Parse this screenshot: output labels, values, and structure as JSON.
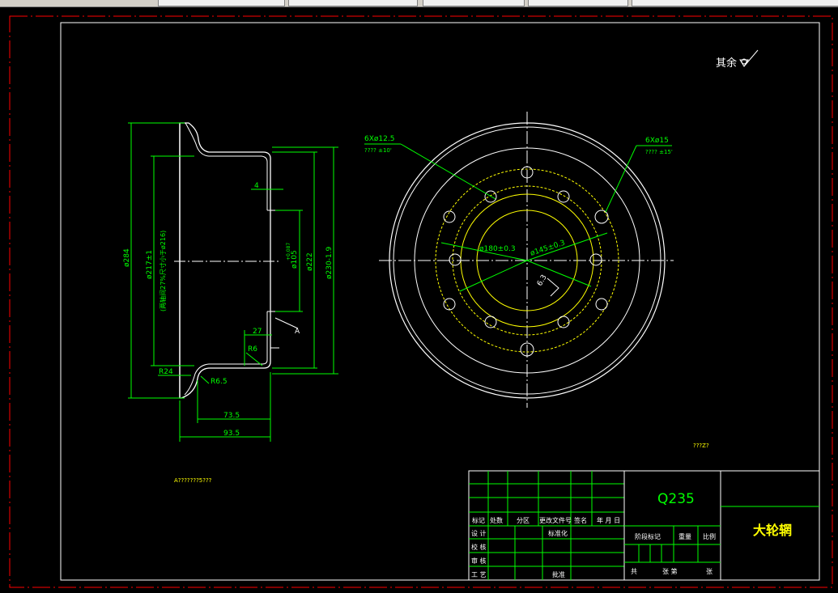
{
  "toolbar": {
    "tabs": [
      "",
      "",
      "",
      "",
      ""
    ]
  },
  "drawing": {
    "roughness_note": "其余",
    "material": "Q235",
    "part_name": "大轮辋",
    "bottom_note": "A???????5???",
    "right_note": "???Z?",
    "dims_side": {
      "d284": "ø284",
      "d217": "ø217±1",
      "d216": "(两轴间27%尺寸小于ø216)",
      "d105": "ø105",
      "d105_tol": "+0.087",
      "d222": "ø222",
      "d230": "ø230-1.9",
      "w4": "4",
      "w27": "27",
      "r6": "R6",
      "r24": "R24",
      "r65": "R6.5",
      "w735": "73.5",
      "w935": "93.5",
      "markA": "A"
    },
    "dims_front": {
      "holes1": "6Xø12.5",
      "holes1_tol": "???? ±10'",
      "holes2": "6Xø15",
      "holes2_tol": "???? ±15'",
      "pcd180": "ø180±0.3",
      "pcd145": "ø145±0.3",
      "rough": "6.3"
    },
    "title_block": {
      "row_labels": [
        "标记",
        "处数",
        "分区",
        "更改文件号",
        "签名",
        "年 月 日"
      ],
      "left_labels": [
        "设 计",
        "校 核",
        "审 核",
        "工 艺"
      ],
      "standard": "标准化",
      "approve": "批准",
      "stage": "阶段标记",
      "weight": "重量",
      "scale": "比例",
      "sheets": [
        "共",
        "张 第",
        "张"
      ]
    }
  }
}
